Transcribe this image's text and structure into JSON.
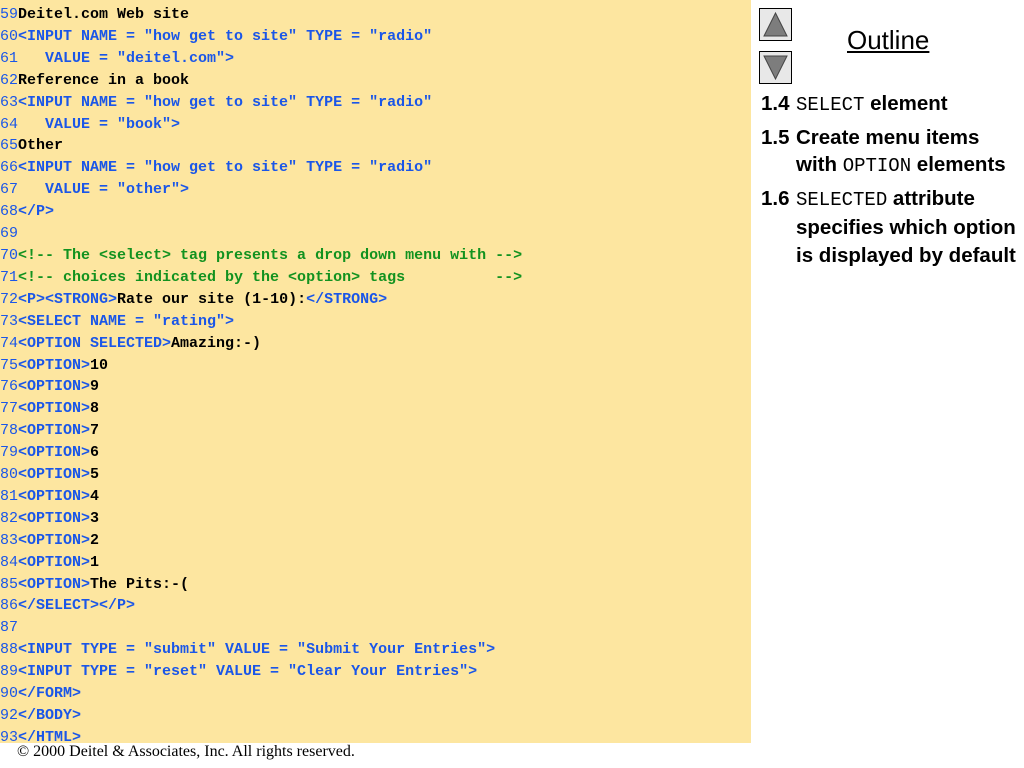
{
  "code_lines": [
    {
      "n": "59",
      "parts": [
        {
          "c": "t",
          "s": "Deitel.com Web site"
        }
      ]
    },
    {
      "n": "60",
      "parts": [
        {
          "c": "k",
          "s": "<INPUT NAME = \"how get to site\" TYPE = \"radio\""
        }
      ]
    },
    {
      "n": "61",
      "parts": [
        {
          "c": "k",
          "s": "   VALUE = \"deitel.com\">"
        }
      ]
    },
    {
      "n": "62",
      "parts": [
        {
          "c": "t",
          "s": "Reference in a book"
        }
      ]
    },
    {
      "n": "63",
      "parts": [
        {
          "c": "k",
          "s": "<INPUT NAME = \"how get to site\" TYPE = \"radio\""
        }
      ]
    },
    {
      "n": "64",
      "parts": [
        {
          "c": "k",
          "s": "   VALUE = \"book\">"
        }
      ]
    },
    {
      "n": "65",
      "parts": [
        {
          "c": "t",
          "s": "Other"
        }
      ]
    },
    {
      "n": "66",
      "parts": [
        {
          "c": "k",
          "s": "<INPUT NAME = \"how get to site\" TYPE = \"radio\""
        }
      ]
    },
    {
      "n": "67",
      "parts": [
        {
          "c": "k",
          "s": "   VALUE = \"other\">"
        }
      ]
    },
    {
      "n": "68",
      "parts": [
        {
          "c": "k",
          "s": "</P>"
        }
      ]
    },
    {
      "n": "69",
      "parts": []
    },
    {
      "n": "70",
      "parts": [
        {
          "c": "c",
          "s": "<!-- The <select> tag presents a drop down menu with -->"
        }
      ]
    },
    {
      "n": "71",
      "parts": [
        {
          "c": "c",
          "s": "<!-- choices indicated by the <option> tags          -->"
        }
      ]
    },
    {
      "n": "72",
      "parts": [
        {
          "c": "k",
          "s": "<P><STRONG>"
        },
        {
          "c": "t",
          "s": "Rate our site (1-10):"
        },
        {
          "c": "k",
          "s": "</STRONG>"
        }
      ]
    },
    {
      "n": "73",
      "parts": [
        {
          "c": "k",
          "s": "<SELECT NAME = \"rating\">"
        }
      ]
    },
    {
      "n": "74",
      "parts": [
        {
          "c": "k",
          "s": "<OPTION SELECTED>"
        },
        {
          "c": "t",
          "s": "Amazing:-)"
        }
      ]
    },
    {
      "n": "75",
      "parts": [
        {
          "c": "k",
          "s": "<OPTION>"
        },
        {
          "c": "t",
          "s": "10"
        }
      ]
    },
    {
      "n": "76",
      "parts": [
        {
          "c": "k",
          "s": "<OPTION>"
        },
        {
          "c": "t",
          "s": "9"
        }
      ]
    },
    {
      "n": "77",
      "parts": [
        {
          "c": "k",
          "s": "<OPTION>"
        },
        {
          "c": "t",
          "s": "8"
        }
      ]
    },
    {
      "n": "78",
      "parts": [
        {
          "c": "k",
          "s": "<OPTION>"
        },
        {
          "c": "t",
          "s": "7"
        }
      ]
    },
    {
      "n": "79",
      "parts": [
        {
          "c": "k",
          "s": "<OPTION>"
        },
        {
          "c": "t",
          "s": "6"
        }
      ]
    },
    {
      "n": "80",
      "parts": [
        {
          "c": "k",
          "s": "<OPTION>"
        },
        {
          "c": "t",
          "s": "5"
        }
      ]
    },
    {
      "n": "81",
      "parts": [
        {
          "c": "k",
          "s": "<OPTION>"
        },
        {
          "c": "t",
          "s": "4"
        }
      ]
    },
    {
      "n": "82",
      "parts": [
        {
          "c": "k",
          "s": "<OPTION>"
        },
        {
          "c": "t",
          "s": "3"
        }
      ]
    },
    {
      "n": "83",
      "parts": [
        {
          "c": "k",
          "s": "<OPTION>"
        },
        {
          "c": "t",
          "s": "2"
        }
      ]
    },
    {
      "n": "84",
      "parts": [
        {
          "c": "k",
          "s": "<OPTION>"
        },
        {
          "c": "t",
          "s": "1"
        }
      ]
    },
    {
      "n": "85",
      "parts": [
        {
          "c": "k",
          "s": "<OPTION>"
        },
        {
          "c": "t",
          "s": "The Pits:-("
        }
      ]
    },
    {
      "n": "86",
      "parts": [
        {
          "c": "k",
          "s": "</SELECT></P>"
        }
      ]
    },
    {
      "n": "87",
      "parts": []
    },
    {
      "n": "88",
      "parts": [
        {
          "c": "k",
          "s": "<INPUT TYPE = \"submit\" VALUE = \"Submit Your Entries\">"
        }
      ]
    },
    {
      "n": "89",
      "parts": [
        {
          "c": "k",
          "s": "<INPUT TYPE = \"reset\" VALUE = \"Clear Your Entries\">"
        }
      ]
    },
    {
      "n": "90",
      "parts": [
        {
          "c": "k",
          "s": "</FORM>"
        }
      ]
    },
    {
      "n": "92",
      "parts": [
        {
          "c": "k",
          "s": "</BODY>"
        }
      ]
    },
    {
      "n": "93",
      "parts": [
        {
          "c": "k",
          "s": "</HTML>"
        }
      ]
    }
  ],
  "nav": {
    "up_icon": "triangle-up-icon",
    "down_icon": "triangle-down-icon"
  },
  "outline": {
    "title": "Outline",
    "items": [
      {
        "num": "1.4",
        "pre": "",
        "code": "SELECT",
        "post": " element"
      },
      {
        "num": "1.5",
        "pre": "Create menu items with ",
        "code": "OPTION",
        "post": " elements"
      },
      {
        "num": "1.6",
        "pre": "",
        "code": "SELECTED",
        "post": " attribute specifies which option is displayed by default"
      }
    ]
  },
  "footer": "© 2000 Deitel & Associates, Inc.  All rights reserved.",
  "colors": {
    "code_background": "#fde6a0",
    "keyword": "#1a56e8",
    "comment": "#12921f",
    "text": "#000000"
  }
}
